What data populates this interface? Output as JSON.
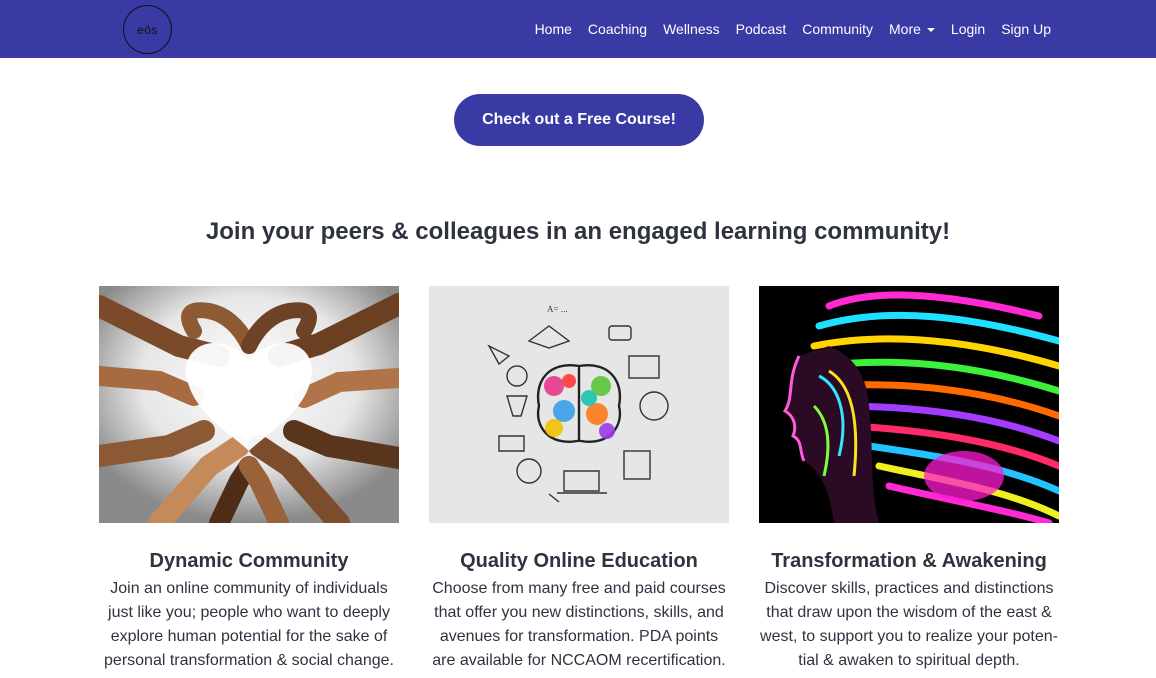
{
  "brand": {
    "logo_text": "eōs"
  },
  "nav": {
    "items": [
      "Home",
      "Coaching",
      "Wellness",
      "Podcast",
      "Community"
    ],
    "more_label": "More",
    "login_label": "Login",
    "signup_label": "Sign Up"
  },
  "cta": {
    "label": "Check out a Free Course!"
  },
  "section": {
    "heading": "Join your peers & colleagues in an engaged learning community!"
  },
  "cards": [
    {
      "title": "Dynamic Community",
      "lines": [
        "Join an online community of individuals",
        "just like you; people who want to deeply",
        "explore human potential for the sake of",
        "personal transformation & social change."
      ]
    },
    {
      "title": "Quality Online Education",
      "lines": [
        "Choose from many free and paid courses",
        "that offer you new distinctions, skills, and",
        "avenues for transformation. PDA points",
        "are available for NCCAOM recertification."
      ]
    },
    {
      "title": "Transformation & Awakening",
      "lines": [
        "Discover skills, practices and distinctions",
        "that draw upon the wisdom of the east &",
        "west, to support you to realize your poten-",
        "tial & awaken to spiritual depth."
      ]
    }
  ],
  "colors": {
    "brand": "#3a3aa4",
    "heading": "#2f3340"
  }
}
